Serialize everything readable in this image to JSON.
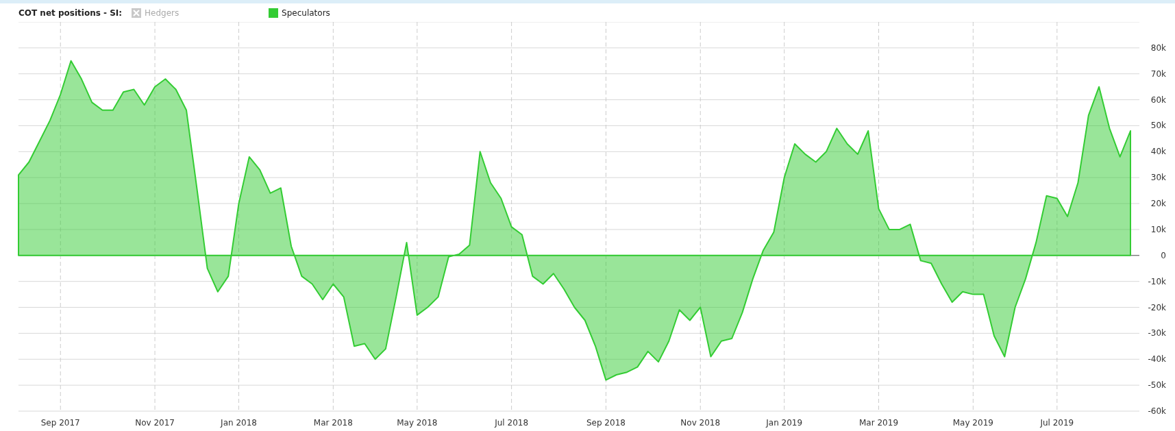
{
  "legend": {
    "title": "COT net positions - SI:",
    "items": [
      {
        "label": "Hedgers",
        "enabled": false
      }
    ]
  },
  "chart": {
    "chart_data": {
      "type": "area",
      "categories": [
        null,
        null,
        null,
        null,
        "Sep 2017",
        null,
        null,
        null,
        null,
        null,
        null,
        null,
        null,
        "Nov 2017",
        null,
        null,
        null,
        null,
        null,
        null,
        null,
        "Jan 2018",
        null,
        null,
        null,
        null,
        null,
        null,
        null,
        null,
        "Mar 2018",
        null,
        null,
        null,
        null,
        null,
        null,
        null,
        "May 2018",
        null,
        null,
        null,
        null,
        null,
        null,
        null,
        null,
        "Jul 2018",
        null,
        null,
        null,
        null,
        null,
        null,
        null,
        null,
        "Sep 2018",
        null,
        null,
        null,
        null,
        null,
        null,
        null,
        null,
        "Nov 2018",
        null,
        null,
        null,
        null,
        null,
        null,
        null,
        "Jan 2019",
        null,
        null,
        null,
        null,
        null,
        null,
        null,
        null,
        "Mar 2019",
        null,
        null,
        null,
        null,
        null,
        null,
        null,
        null,
        "May 2019",
        null,
        null,
        null,
        null,
        null,
        null,
        null,
        "Jul 2019",
        null,
        null,
        null,
        null,
        null,
        null,
        null
      ],
      "series": [
        {
          "name": "Speculators",
          "color": "#33cc33",
          "values": [
            31000,
            36000,
            44000,
            52000,
            62000,
            75000,
            68000,
            59000,
            56000,
            56000,
            63000,
            64000,
            58000,
            65000,
            68000,
            64000,
            56000,
            26000,
            -5000,
            -14000,
            -8000,
            20000,
            38000,
            33000,
            24000,
            26000,
            3500,
            -8000,
            -11000,
            -17000,
            -11000,
            -16000,
            -35000,
            -34000,
            -40000,
            -36000,
            -16000,
            5000,
            -23000,
            -20000,
            -16000,
            -500,
            500,
            4000,
            40000,
            28000,
            22000,
            11000,
            8000,
            -8000,
            -11000,
            -7000,
            -13000,
            -20000,
            -25000,
            -35000,
            -48000,
            -46000,
            -45000,
            -43000,
            -37000,
            -41000,
            -33000,
            -21000,
            -25000,
            -20000,
            -39000,
            -33000,
            -32000,
            -22000,
            -9000,
            2000,
            9000,
            30000,
            43000,
            39000,
            36000,
            40000,
            49000,
            43000,
            39000,
            48000,
            18000,
            10000,
            10000,
            12000,
            -2000,
            -3000,
            -11000,
            -18000,
            -14000,
            -15000,
            -15000,
            -31000,
            -39000,
            -20000,
            -9000,
            5000,
            23000,
            22000,
            15000,
            28000,
            54000,
            65000,
            49000,
            38000,
            48000
          ]
        }
      ],
      "grid": true,
      "ylim": [
        -60000,
        90000
      ],
      "yticks": [
        {
          "value": -60000,
          "label": "-60k"
        },
        {
          "value": -50000,
          "label": "-50k"
        },
        {
          "value": -40000,
          "label": "-40k"
        },
        {
          "value": -30000,
          "label": "-30k"
        },
        {
          "value": -20000,
          "label": "-20k"
        },
        {
          "value": -10000,
          "label": "-10k"
        },
        {
          "value": 0,
          "label": "0"
        },
        {
          "value": 10000,
          "label": "10k"
        },
        {
          "value": 20000,
          "label": "20k"
        },
        {
          "value": 30000,
          "label": "30k"
        },
        {
          "value": 40000,
          "label": "40k"
        },
        {
          "value": 50000,
          "label": "50k"
        },
        {
          "value": 60000,
          "label": "60k"
        },
        {
          "value": 70000,
          "label": "70k"
        },
        {
          "value": 80000,
          "label": "80k"
        }
      ]
    }
  }
}
